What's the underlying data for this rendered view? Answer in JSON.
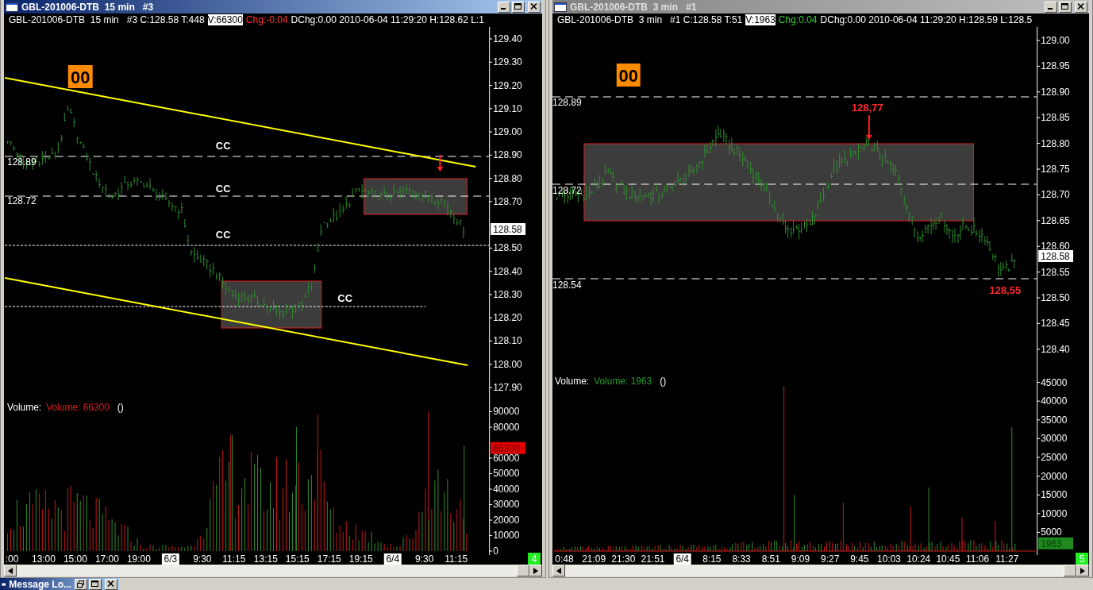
{
  "windows": [
    {
      "kind": "channel",
      "title": "GBL-201006-DTB  15 min   #3",
      "active": true,
      "info": {
        "instrument": "GBL-201006-DTB  15 min   #3 C:128.58 T:448",
        "volume": "V:66300",
        "change": "Chg:-0.04",
        "falling": true,
        "details": "DChg:0.00 2010-06-04 11:29:20 H:128.62 L:1"
      },
      "price_ticks": [
        "129.40",
        "129.30",
        "129.20",
        "129.10",
        "129.00",
        "128.90",
        "128.80",
        "128.70",
        "128.50",
        "128.40",
        "128.30",
        "128.20",
        "128.10",
        "128.00",
        "127.90"
      ],
      "last_price": "128.58",
      "level_labels": [
        "128.89",
        "128.72"
      ],
      "marker": "00",
      "notes": [
        "CC",
        "CC",
        "CC",
        "CC"
      ],
      "volume_title": "Volume:",
      "volume_reading": "Volume: 66300",
      "volume_extra": "()",
      "volume_ticks": [
        "90000",
        "80000",
        "60000",
        "50000",
        "40000",
        "30000",
        "20000",
        "10000",
        "0"
      ],
      "volume_last": "66300",
      "time_labels": [
        {
          "text": ":00",
          "date": false
        },
        {
          "text": "13:00",
          "date": false
        },
        {
          "text": "15:00",
          "date": false
        },
        {
          "text": "17:00",
          "date": false
        },
        {
          "text": "19:00",
          "date": false
        },
        {
          "text": "6/3",
          "date": true
        },
        {
          "text": "9:30",
          "date": false
        },
        {
          "text": "11:15",
          "date": false
        },
        {
          "text": "13:15",
          "date": false
        },
        {
          "text": "15:15",
          "date": false
        },
        {
          "text": "17:15",
          "date": false
        },
        {
          "text": "19:15",
          "date": false
        },
        {
          "text": "6/4",
          "date": true
        },
        {
          "text": "9:30",
          "date": false
        },
        {
          "text": "11:15",
          "date": false
        }
      ],
      "page_badge": "4"
    },
    {
      "kind": "range",
      "title": "GBL-201006-DTB  3 min   #1",
      "active": false,
      "info": {
        "instrument": "GBL-201006-DTB  3 min   #1 C:128.58 T:51",
        "volume": "V:1963",
        "change": "Chg:0.04",
        "falling": false,
        "details": "DChg:0.00 2010-06-04 11:29:20 H:128.59 L:128.5"
      },
      "price_ticks": [
        "129.00",
        "128.95",
        "128.90",
        "128.85",
        "128.80",
        "128.75",
        "128.70",
        "128.65",
        "128.60",
        "128.55",
        "128.50",
        "128.45",
        "128.40"
      ],
      "last_price": "128.58",
      "level_labels": [
        "128.89",
        "128.72",
        "128.54"
      ],
      "marker": "00",
      "notes": [
        "128,77",
        "128,55"
      ],
      "volume_title": "Volume:",
      "volume_reading": "Volume: 1963",
      "volume_extra": "()",
      "volume_ticks": [
        "45000",
        "40000",
        "35000",
        "30000",
        "25000",
        "20000",
        "15000",
        "10000",
        "5000"
      ],
      "volume_last": "1963",
      "time_labels": [
        {
          "text": "0:48",
          "date": false
        },
        {
          "text": "21:09",
          "date": false
        },
        {
          "text": "21:30",
          "date": false
        },
        {
          "text": "21:51",
          "date": false
        },
        {
          "text": "6/4",
          "date": true
        },
        {
          "text": "8:15",
          "date": false
        },
        {
          "text": "8:33",
          "date": false
        },
        {
          "text": "8:51",
          "date": false
        },
        {
          "text": "9:09",
          "date": false
        },
        {
          "text": "9:27",
          "date": false
        },
        {
          "text": "9:45",
          "date": false
        },
        {
          "text": "10:03",
          "date": false
        },
        {
          "text": "10:24",
          "date": false
        },
        {
          "text": "10:45",
          "date": false
        },
        {
          "text": "11:06",
          "date": false
        },
        {
          "text": "11:27",
          "date": false
        }
      ],
      "page_badge": "5"
    }
  ],
  "minimized": {
    "title": "Message Lo..."
  }
}
